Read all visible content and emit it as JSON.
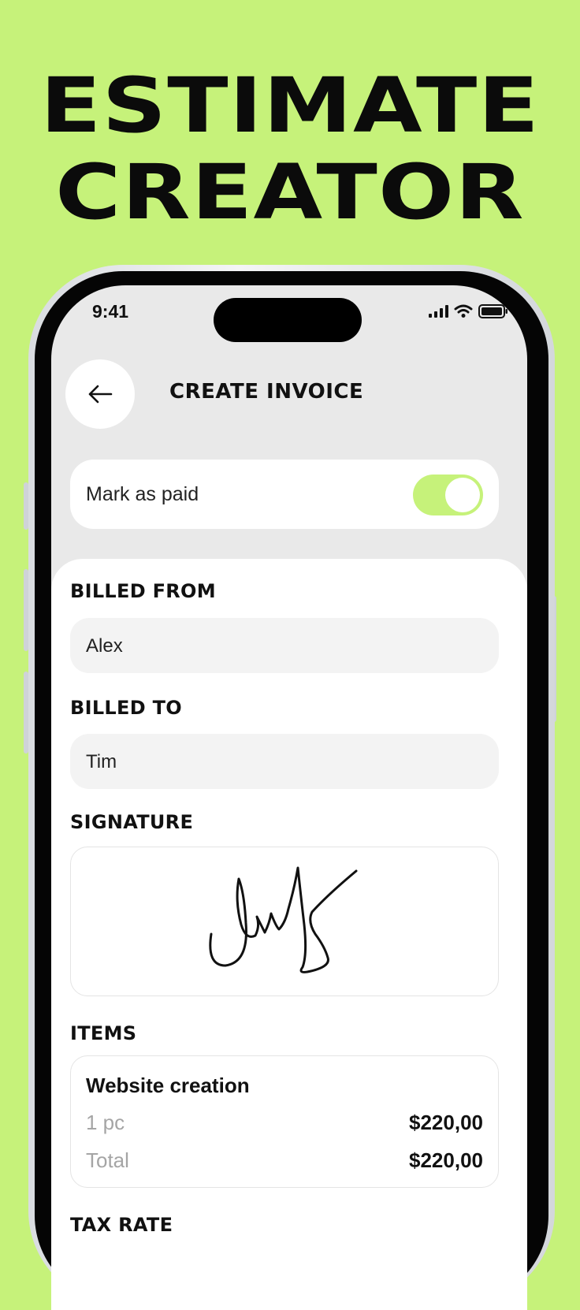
{
  "headline": {
    "line1": "ESTIMATE",
    "line2": "CREATOR"
  },
  "status_bar": {
    "time": "9:41",
    "icons": [
      "signal-icon",
      "wifi-icon",
      "battery-icon"
    ]
  },
  "header": {
    "back_icon": "arrow-left-icon",
    "title": "CREATE INVOICE"
  },
  "mark_paid": {
    "label": "Mark as paid",
    "toggle_on": true
  },
  "billed_from": {
    "label": "BILLED FROM",
    "value": "Alex"
  },
  "billed_to": {
    "label": "BILLED TO",
    "value": "Tim"
  },
  "signature": {
    "label": "SIGNATURE"
  },
  "items": {
    "label": "ITEMS",
    "list": [
      {
        "name": "Website creation",
        "qty": "1 pc",
        "price": "$220,00",
        "total_label": "Total",
        "total": "$220,00"
      }
    ]
  },
  "tax_rate": {
    "label": "TAX RATE"
  },
  "colors": {
    "accent": "#c6f27a",
    "text": "#111111",
    "muted": "#a5a5a5"
  }
}
